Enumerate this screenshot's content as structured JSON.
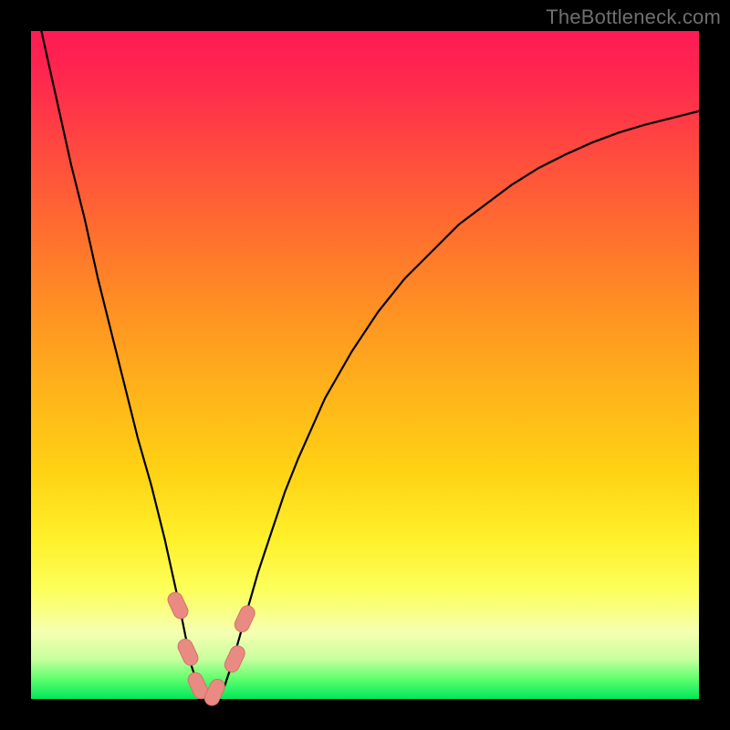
{
  "watermark": "TheBottleneck.com",
  "colors": {
    "frame": "#000000",
    "curve_stroke": "#000000",
    "marker_fill": "#e98b82",
    "marker_stroke": "#d2736a"
  },
  "chart_data": {
    "type": "line",
    "title": "",
    "xlabel": "",
    "ylabel": "",
    "xlim": [
      0,
      100
    ],
    "ylim": [
      0,
      100
    ],
    "x": [
      0,
      2,
      4,
      6,
      8,
      10,
      12,
      14,
      16,
      18,
      20,
      22,
      23,
      24,
      25,
      26,
      27,
      28,
      29,
      30,
      32,
      34,
      36,
      38,
      40,
      44,
      48,
      52,
      56,
      60,
      64,
      68,
      72,
      76,
      80,
      84,
      88,
      92,
      96,
      100
    ],
    "values": [
      107,
      98,
      89,
      80,
      72,
      63,
      55,
      47,
      39,
      32,
      24,
      15,
      10,
      5,
      2,
      0.5,
      0,
      0.5,
      2,
      5,
      12,
      19,
      25,
      31,
      36,
      45,
      52,
      58,
      63,
      67,
      71,
      74,
      77,
      79.5,
      81.5,
      83.3,
      84.8,
      86,
      87,
      88
    ],
    "markers": [
      {
        "x": 22.0,
        "y": 14
      },
      {
        "x": 23.5,
        "y": 7
      },
      {
        "x": 25.0,
        "y": 2
      },
      {
        "x": 27.5,
        "y": 1
      },
      {
        "x": 30.5,
        "y": 6
      },
      {
        "x": 32.0,
        "y": 12
      }
    ],
    "grid": false,
    "legend": false
  }
}
